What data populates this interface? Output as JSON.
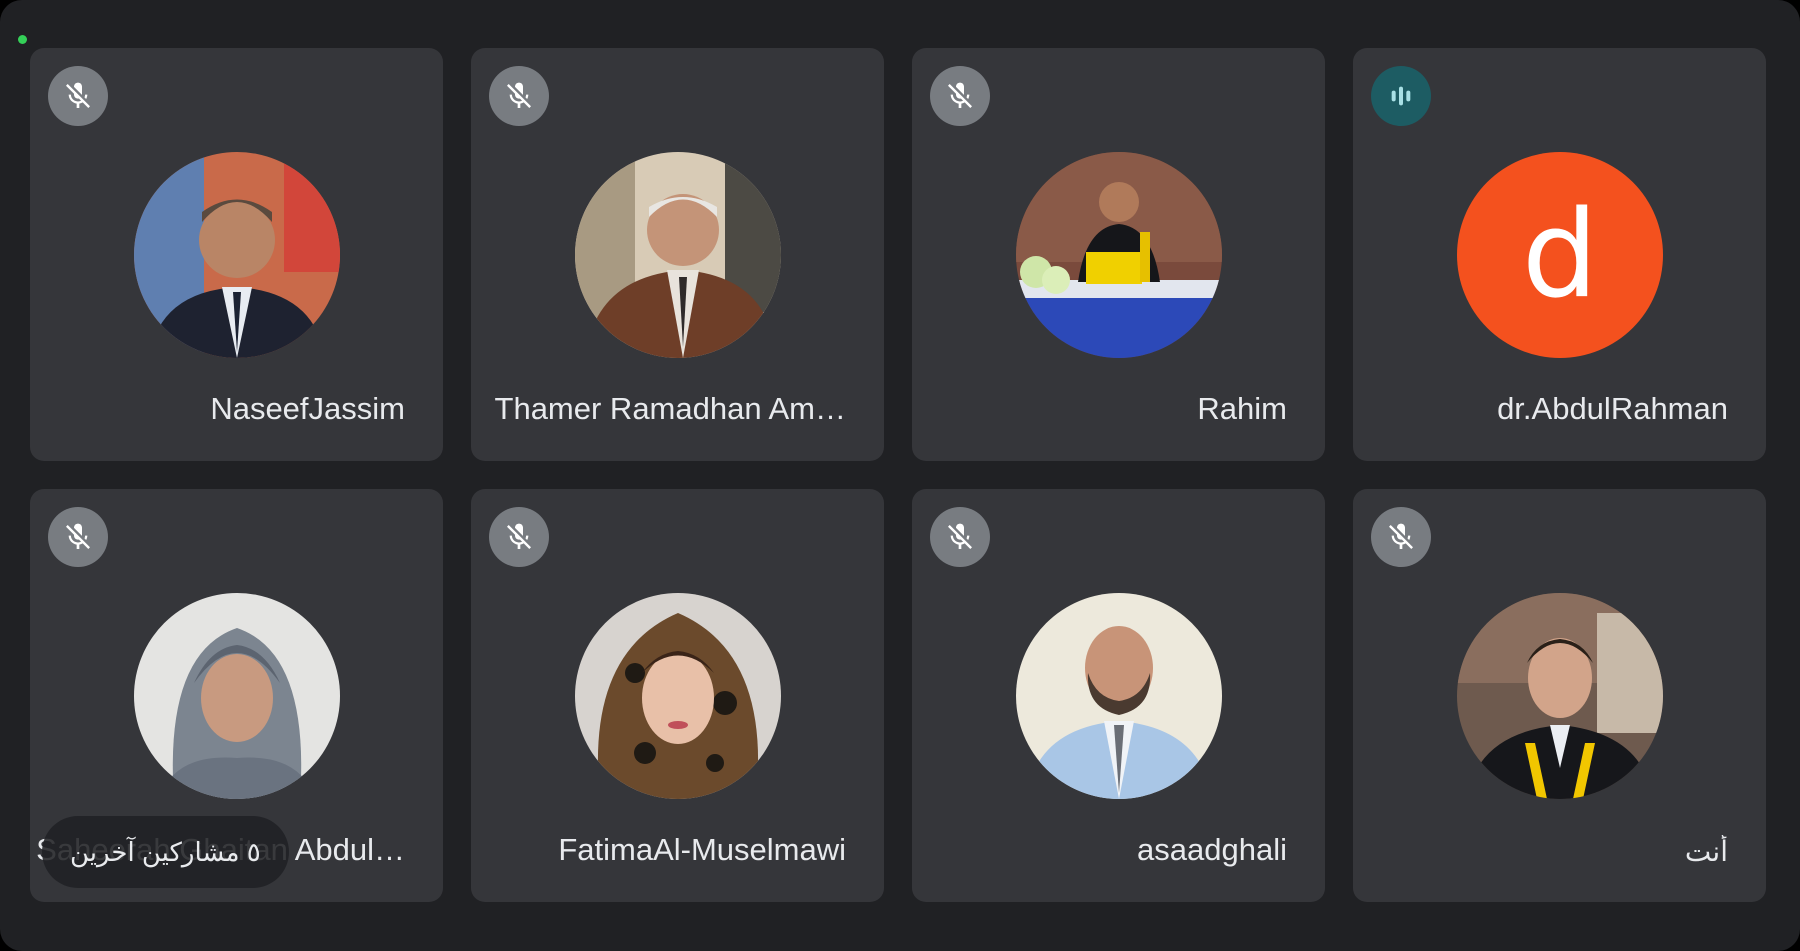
{
  "participants": [
    {
      "name": "NaseefJassim",
      "mic": "muted",
      "avatar": "photo"
    },
    {
      "name": "Thamer Ramadhan Am…",
      "mic": "muted",
      "avatar": "photo"
    },
    {
      "name": "Rahim",
      "mic": "muted",
      "avatar": "photo"
    },
    {
      "name": "dr.AbdulRahman",
      "mic": "speaking",
      "avatar": "letter",
      "letter": "d",
      "avatar_color": "#f4511e"
    },
    {
      "name": "Saheerah Ghaitan Abdul…",
      "mic": "muted",
      "avatar": "photo"
    },
    {
      "name": "FatimaAl-Muselmawi",
      "mic": "muted",
      "avatar": "photo"
    },
    {
      "name": "asaadghali",
      "mic": "muted",
      "avatar": "photo"
    },
    {
      "name": "أنت",
      "mic": "muted",
      "avatar": "photo"
    }
  ],
  "others_chip": "٥ مشاركين آخرين",
  "icons": {
    "muted": "mic-off-icon",
    "speaking": "audio-level-icon"
  },
  "colors": {
    "background": "#202124",
    "tile": "#35363a",
    "speaking": "#1d5c63",
    "letter_avatar": "#f4511e"
  }
}
